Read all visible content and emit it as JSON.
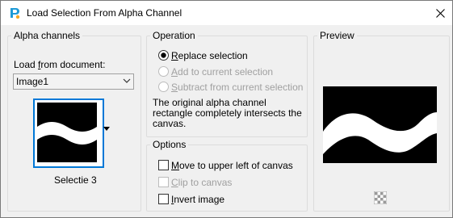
{
  "window": {
    "title": "Load Selection From Alpha Channel"
  },
  "alpha_channels": {
    "group_title": "Alpha channels",
    "load_label_pre": "Load ",
    "load_label_u": "f",
    "load_label_post": "rom document:",
    "document_value": "Image1",
    "channel_name": "Selectie 3"
  },
  "operation": {
    "group_title": "Operation",
    "options": [
      {
        "u": "R",
        "rest": "eplace selection",
        "selected": true,
        "enabled": true
      },
      {
        "u": "A",
        "rest": "dd to current selection",
        "selected": false,
        "enabled": false
      },
      {
        "u": "S",
        "rest": "ubtract from current selection",
        "selected": false,
        "enabled": false
      }
    ],
    "description": "The original alpha channel rectangle completely intersects the canvas."
  },
  "options": {
    "group_title": "Options",
    "checkboxes": [
      {
        "u": "M",
        "rest": "ove to upper left of canvas",
        "checked": false,
        "enabled": true
      },
      {
        "u": "C",
        "rest": "lip to canvas",
        "checked": false,
        "enabled": false
      },
      {
        "u": "I",
        "rest": "nvert image",
        "checked": false,
        "enabled": true
      }
    ]
  },
  "preview": {
    "group_title": "Preview"
  },
  "icons": [
    "app-icon",
    "close-icon",
    "chevron-down-icon",
    "dropdown-arrow-icon",
    "checkerboard-icon"
  ]
}
